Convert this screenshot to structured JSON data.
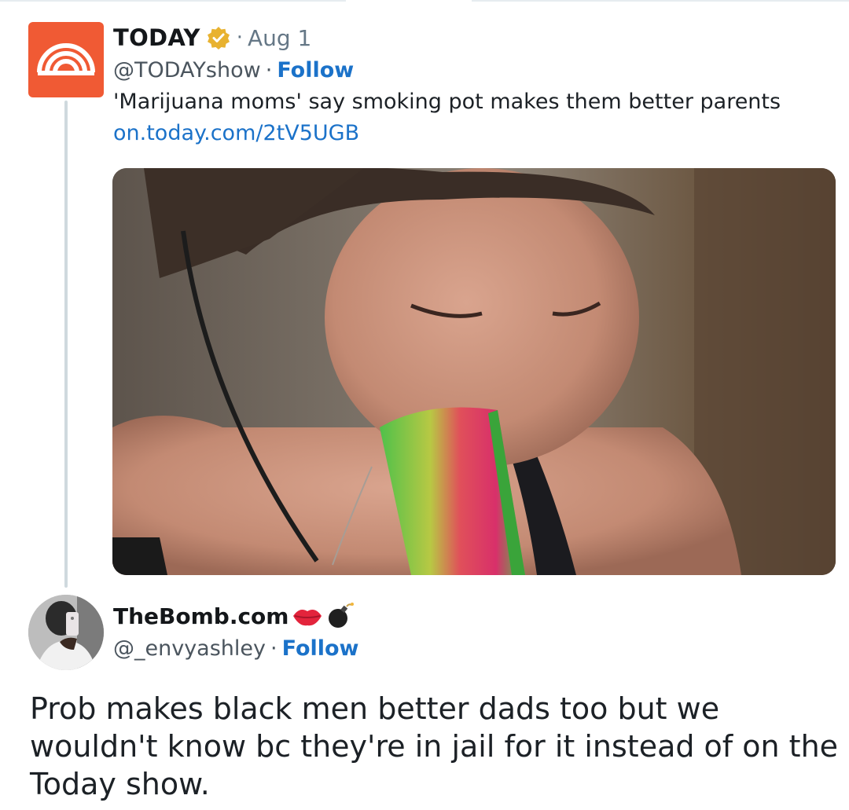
{
  "tweet": {
    "display_name": "TODAY",
    "separator": "·",
    "date": "Aug 1",
    "handle": "@TODAYshow",
    "follow_label": "Follow",
    "text": "'Marijuana moms' say smoking pot makes them better parents",
    "link": "on.today.com/2tV5UGB",
    "avatar_icon": "today-logo-icon",
    "verified_icon": "verified-badge-icon",
    "media_icon": "tweet-photo"
  },
  "reply": {
    "display_name": "TheBomb.com",
    "name_emojis": [
      "lips-emoji-icon",
      "bomb-emoji-icon"
    ],
    "handle": "@_envyashley",
    "separator": "·",
    "follow_label": "Follow",
    "text": "Prob makes black men better dads too but we wouldn't know bc they're in jail for it instead of on the Today show."
  },
  "colors": {
    "link": "#1b72c9",
    "today_brand": "#f05a34",
    "verified": "#e8b230",
    "muted_text": "#657786"
  }
}
